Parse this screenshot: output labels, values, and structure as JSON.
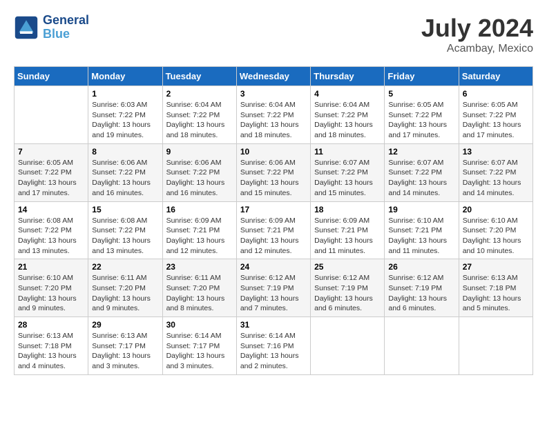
{
  "header": {
    "logo_general": "General",
    "logo_blue": "Blue",
    "month_year": "July 2024",
    "location": "Acambay, Mexico"
  },
  "days_of_week": [
    "Sunday",
    "Monday",
    "Tuesday",
    "Wednesday",
    "Thursday",
    "Friday",
    "Saturday"
  ],
  "weeks": [
    [
      {
        "day": "",
        "info": ""
      },
      {
        "day": "1",
        "info": "Sunrise: 6:03 AM\nSunset: 7:22 PM\nDaylight: 13 hours\nand 19 minutes."
      },
      {
        "day": "2",
        "info": "Sunrise: 6:04 AM\nSunset: 7:22 PM\nDaylight: 13 hours\nand 18 minutes."
      },
      {
        "day": "3",
        "info": "Sunrise: 6:04 AM\nSunset: 7:22 PM\nDaylight: 13 hours\nand 18 minutes."
      },
      {
        "day": "4",
        "info": "Sunrise: 6:04 AM\nSunset: 7:22 PM\nDaylight: 13 hours\nand 18 minutes."
      },
      {
        "day": "5",
        "info": "Sunrise: 6:05 AM\nSunset: 7:22 PM\nDaylight: 13 hours\nand 17 minutes."
      },
      {
        "day": "6",
        "info": "Sunrise: 6:05 AM\nSunset: 7:22 PM\nDaylight: 13 hours\nand 17 minutes."
      }
    ],
    [
      {
        "day": "7",
        "info": "Sunrise: 6:05 AM\nSunset: 7:22 PM\nDaylight: 13 hours\nand 17 minutes."
      },
      {
        "day": "8",
        "info": "Sunrise: 6:06 AM\nSunset: 7:22 PM\nDaylight: 13 hours\nand 16 minutes."
      },
      {
        "day": "9",
        "info": "Sunrise: 6:06 AM\nSunset: 7:22 PM\nDaylight: 13 hours\nand 16 minutes."
      },
      {
        "day": "10",
        "info": "Sunrise: 6:06 AM\nSunset: 7:22 PM\nDaylight: 13 hours\nand 15 minutes."
      },
      {
        "day": "11",
        "info": "Sunrise: 6:07 AM\nSunset: 7:22 PM\nDaylight: 13 hours\nand 15 minutes."
      },
      {
        "day": "12",
        "info": "Sunrise: 6:07 AM\nSunset: 7:22 PM\nDaylight: 13 hours\nand 14 minutes."
      },
      {
        "day": "13",
        "info": "Sunrise: 6:07 AM\nSunset: 7:22 PM\nDaylight: 13 hours\nand 14 minutes."
      }
    ],
    [
      {
        "day": "14",
        "info": "Sunrise: 6:08 AM\nSunset: 7:22 PM\nDaylight: 13 hours\nand 13 minutes."
      },
      {
        "day": "15",
        "info": "Sunrise: 6:08 AM\nSunset: 7:22 PM\nDaylight: 13 hours\nand 13 minutes."
      },
      {
        "day": "16",
        "info": "Sunrise: 6:09 AM\nSunset: 7:21 PM\nDaylight: 13 hours\nand 12 minutes."
      },
      {
        "day": "17",
        "info": "Sunrise: 6:09 AM\nSunset: 7:21 PM\nDaylight: 13 hours\nand 12 minutes."
      },
      {
        "day": "18",
        "info": "Sunrise: 6:09 AM\nSunset: 7:21 PM\nDaylight: 13 hours\nand 11 minutes."
      },
      {
        "day": "19",
        "info": "Sunrise: 6:10 AM\nSunset: 7:21 PM\nDaylight: 13 hours\nand 11 minutes."
      },
      {
        "day": "20",
        "info": "Sunrise: 6:10 AM\nSunset: 7:20 PM\nDaylight: 13 hours\nand 10 minutes."
      }
    ],
    [
      {
        "day": "21",
        "info": "Sunrise: 6:10 AM\nSunset: 7:20 PM\nDaylight: 13 hours\nand 9 minutes."
      },
      {
        "day": "22",
        "info": "Sunrise: 6:11 AM\nSunset: 7:20 PM\nDaylight: 13 hours\nand 9 minutes."
      },
      {
        "day": "23",
        "info": "Sunrise: 6:11 AM\nSunset: 7:20 PM\nDaylight: 13 hours\nand 8 minutes."
      },
      {
        "day": "24",
        "info": "Sunrise: 6:12 AM\nSunset: 7:19 PM\nDaylight: 13 hours\nand 7 minutes."
      },
      {
        "day": "25",
        "info": "Sunrise: 6:12 AM\nSunset: 7:19 PM\nDaylight: 13 hours\nand 6 minutes."
      },
      {
        "day": "26",
        "info": "Sunrise: 6:12 AM\nSunset: 7:19 PM\nDaylight: 13 hours\nand 6 minutes."
      },
      {
        "day": "27",
        "info": "Sunrise: 6:13 AM\nSunset: 7:18 PM\nDaylight: 13 hours\nand 5 minutes."
      }
    ],
    [
      {
        "day": "28",
        "info": "Sunrise: 6:13 AM\nSunset: 7:18 PM\nDaylight: 13 hours\nand 4 minutes."
      },
      {
        "day": "29",
        "info": "Sunrise: 6:13 AM\nSunset: 7:17 PM\nDaylight: 13 hours\nand 3 minutes."
      },
      {
        "day": "30",
        "info": "Sunrise: 6:14 AM\nSunset: 7:17 PM\nDaylight: 13 hours\nand 3 minutes."
      },
      {
        "day": "31",
        "info": "Sunrise: 6:14 AM\nSunset: 7:16 PM\nDaylight: 13 hours\nand 2 minutes."
      },
      {
        "day": "",
        "info": ""
      },
      {
        "day": "",
        "info": ""
      },
      {
        "day": "",
        "info": ""
      }
    ]
  ]
}
